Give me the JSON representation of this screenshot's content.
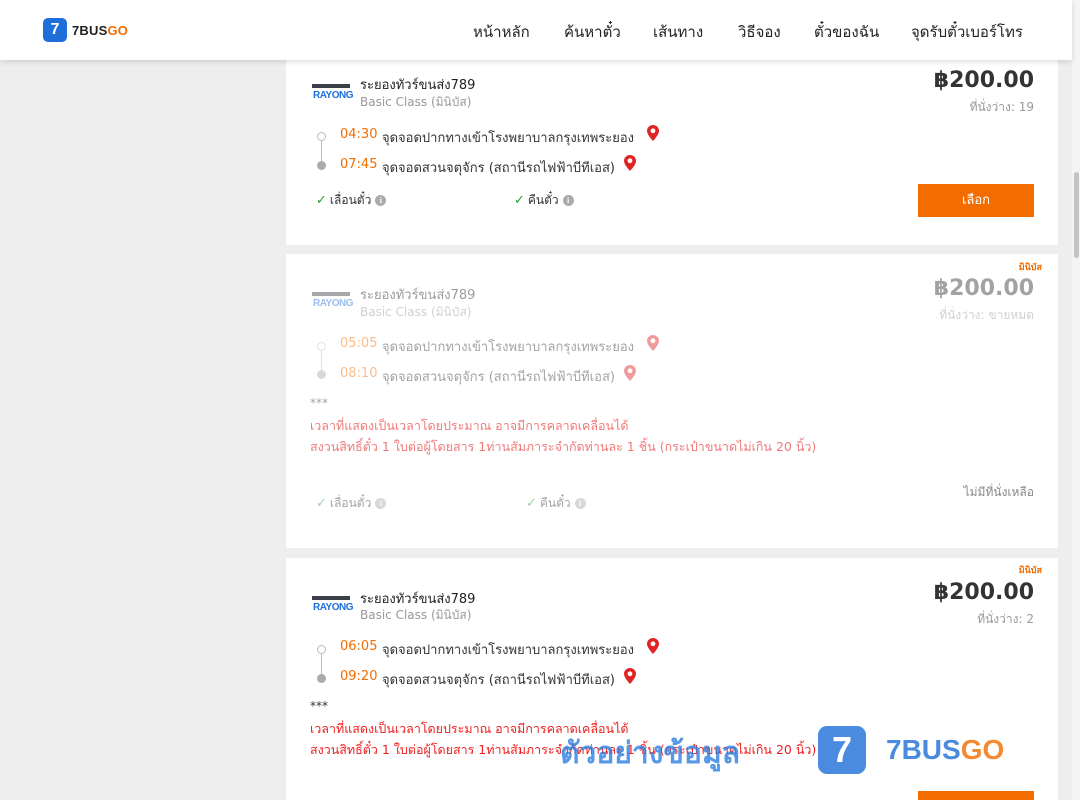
{
  "brand": {
    "badge": "7",
    "name_a": "7BUS",
    "name_b": "GO"
  },
  "nav": [
    "หน้าหลัก",
    "ค้นหาตั๋ว",
    "เส้นทาง",
    "วิธีจอง",
    "ตั๋วของฉัน",
    "จุดรับตั๋วเบอร์โทร"
  ],
  "colors": {
    "accent": "#f36c00",
    "brand_blue": "#1e6fd9",
    "warning": "#ee1e1e"
  },
  "trips": [
    {
      "operator_logo": "RAYONG",
      "operator": "ระยองทัวร์ขนส่ง789",
      "class": "Basic Class (มินิบัส)",
      "price": "฿200.00",
      "seats": "ที่นั่งว่าง: 19",
      "tag": "",
      "depart_time": "04:30",
      "depart_stop": "จุดจอดปากทางเข้าโรงพยาบาลกรุงเทพระยอง",
      "arrive_time": "07:45",
      "arrive_stop": "จุดจอดสวนจตุจักร (สถานีรถไฟฟ้าบีทีเอส)",
      "feature_1": "เลื่อนตั๋ว",
      "feature_2": "คืนตั๋ว",
      "action": "เลือก"
    },
    {
      "operator_logo": "RAYONG",
      "operator": "ระยองทัวร์ขนส่ง789",
      "class": "Basic Class (มินิบัส)",
      "price": "฿200.00",
      "seats": "ที่นั่งว่าง: ขายหมด",
      "tag": "มินิบัส",
      "depart_time": "05:05",
      "depart_stop": "จุดจอดปากทางเข้าโรงพยาบาลกรุงเทพระยอง",
      "arrive_time": "08:10",
      "arrive_stop": "จุดจอดสวนจตุจักร (สถานีรถไฟฟ้าบีทีเอส)",
      "stars": "***",
      "notice_1": "เวลาที่แสดงเป็นเวลาโดยประมาณ อาจมีการคลาดเคลื่อนได้",
      "notice_2": "สงวนสิทธิ์ตั๋ว 1 ใบต่อผู้โดยสาร 1ท่านสัมภาระจำกัดท่านละ 1 ชิ้น (กระเป๋าขนาดไม่เกิน 20 นิ้ว)",
      "feature_1": "เลื่อนตั๋ว",
      "feature_2": "คืนตั๋ว",
      "status": "ไม่มีที่นั่งเหลือ"
    },
    {
      "operator_logo": "RAYONG",
      "operator": "ระยองทัวร์ขนส่ง789",
      "class": "Basic Class (มินิบัส)",
      "price": "฿200.00",
      "seats": "ที่นั่งว่าง: 2",
      "tag": "มินิบัส",
      "depart_time": "06:05",
      "depart_stop": "จุดจอดปากทางเข้าโรงพยาบาลกรุงเทพระยอง",
      "arrive_time": "09:20",
      "arrive_stop": "จุดจอดสวนจตุจักร (สถานีรถไฟฟ้าบีทีเอส)",
      "stars": "***",
      "notice_1": "เวลาที่แสดงเป็นเวลาโดยประมาณ อาจมีการคลาดเคลื่อนได้",
      "notice_2": "สงวนสิทธิ์ตั๋ว 1 ใบต่อผู้โดยสาร 1ท่านสัมภาระจำกัดท่านละ 1 ชิ้น (กระเป๋าขนาดไม่เกิน 20 นิ้ว)"
    }
  ],
  "watermark": {
    "text": "ตัวอย่างข้อมูล",
    "badge": "7",
    "brand_a": "7BUS",
    "brand_b": "GO"
  }
}
